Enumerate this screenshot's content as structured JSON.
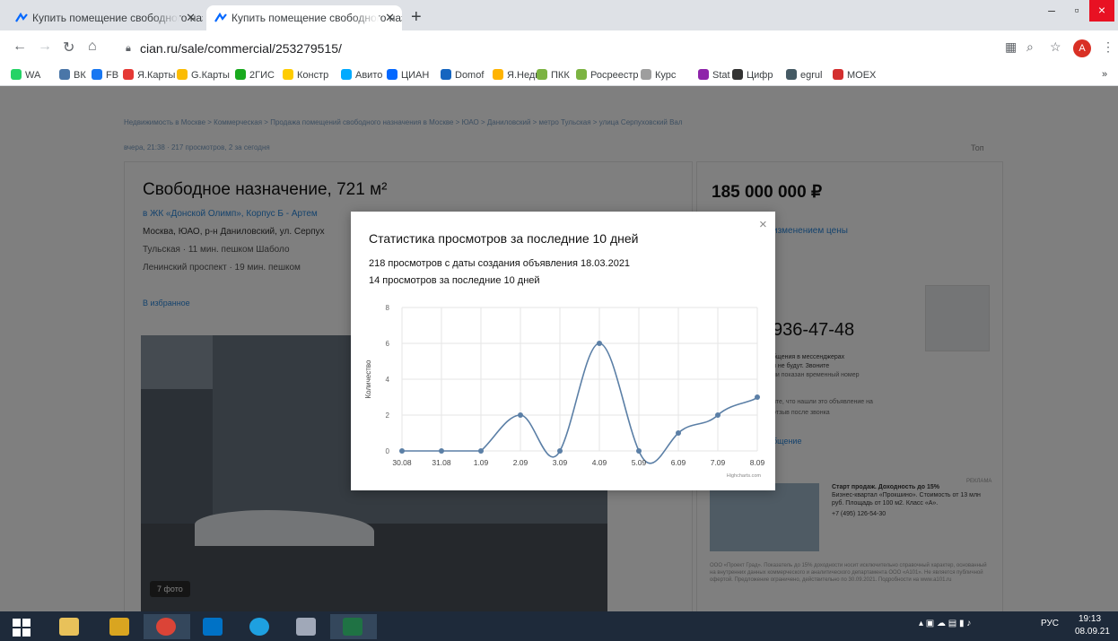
{
  "browser": {
    "tabs": [
      {
        "title": "Купить помещение свободного назначения",
        "active": false
      },
      {
        "title": "Купить помещение свободного назначения",
        "active": true
      }
    ],
    "new_tab": "+",
    "window_controls": {
      "minimize": "‒",
      "maximize": "▫",
      "close": "×"
    },
    "address": "cian.ru/sale/commercial/253279515/",
    "profile_initial": "A",
    "bookmarks": [
      {
        "label": "WA",
        "color": "#25d366"
      },
      {
        "label": "ВК",
        "color": "#4a76a8"
      },
      {
        "label": "FB",
        "color": "#1877f2"
      },
      {
        "label": "Я.Карты",
        "color": "#e53935"
      },
      {
        "label": "G.Карты",
        "color": "#fbbc04"
      },
      {
        "label": "2ГИС",
        "color": "#19aa1e"
      },
      {
        "label": "Констр",
        "color": "#ffcc00"
      },
      {
        "label": "Авито",
        "color": "#00aaff"
      },
      {
        "label": "ЦИАН",
        "color": "#0468ff"
      },
      {
        "label": "Domof",
        "color": "#1565c0"
      },
      {
        "label": "Я.Недв",
        "color": "#ffb300"
      },
      {
        "label": "ПКК",
        "color": "#7cb342"
      },
      {
        "label": "Росреестр",
        "color": "#7cb342"
      },
      {
        "label": "Курс",
        "color": "#9e9e9e"
      },
      {
        "label": "Stat",
        "color": "#8e24aa"
      },
      {
        "label": "Цифр",
        "color": "#333333"
      },
      {
        "label": "egrul",
        "color": "#455a64"
      },
      {
        "label": "MOEX",
        "color": "#d32f2f"
      }
    ],
    "bookmarks_more": "»"
  },
  "page": {
    "breadcrumbs": "Недвижимость в Москве > Коммерческая > Продажа помещений свободного назначения в Москве > ЮАО > Даниловский > метро Тульская > улица Серпуховский Вал",
    "meta": "вчера, 21:38 · 217 просмотров, 2 за сегодня",
    "top_link": "Топ",
    "title": "Свободное назначение, 721 м²",
    "complex": "в ЖК «Донской Олимп», Корпус Б - Артем",
    "address": "Москва, ЮАО, р-н Даниловский, ул. Серпух",
    "metro1": "Тульская · 11 мин. пешком  Шаболо",
    "metro2": "Ленинский проспект · 19 мин. пешком",
    "favorite": "В избранное",
    "photo_count": "7 фото",
    "price": "185 000 000 ₽",
    "price_note": "изменением цены",
    "phone": "936-47-48",
    "phone_note1": "бщения в мессенджерах",
    "phone_note2": "и не будут. Звоните",
    "phone_note3": "ни показан временный номер",
    "phone_note4": "ите, что нашли это объявление на",
    "phone_note5": "отзыв после звонка",
    "message_btn": "бщение",
    "ad_label": "РЕКЛАМА",
    "ad_title": "Старт продаж. Доходность до 15%",
    "ad_text": "Бизнес-квартал «Прокшино». Стоимость от 13 млн руб. Площадь от 100 м2. Класс «А».",
    "ad_phone": "+7 (495) 126-54-30",
    "ad_fine": "ООО «Проект Град». Показатель до 15% доходности носит исключительно справочный характер, основанный на внутренних данных коммерческого и аналитического департамента ООО «А101». Не является публичной офертой. Предложение ограничено, действительно по 30.09.2021. Подробности на www.a101.ru"
  },
  "modal": {
    "close": "×",
    "title": "Статистика просмотров за последние 10 дней",
    "line1": "218 просмотров с даты создания объявления 18.03.2021",
    "line2": "14 просмотров за последние 10 дней",
    "credit": "Highcharts.com"
  },
  "chart_data": {
    "type": "line",
    "categories": [
      "30.08",
      "31.08",
      "1.09",
      "2.09",
      "3.09",
      "4.09",
      "5.09",
      "6.09",
      "7.09",
      "8.09"
    ],
    "values": [
      0,
      0,
      0,
      2,
      0,
      6,
      0,
      1,
      2,
      3
    ],
    "title": "",
    "xlabel": "",
    "ylabel": "Количество",
    "ylim": [
      0,
      8
    ],
    "yticks": [
      0,
      2,
      4,
      6,
      8
    ],
    "grid": true,
    "color": "#5b7fa6"
  },
  "taskbar": {
    "lang": "РУС",
    "time": "19:13",
    "date": "08.09.21"
  },
  "colors": {
    "accent": "#0468ff",
    "link": "#2b87db"
  }
}
